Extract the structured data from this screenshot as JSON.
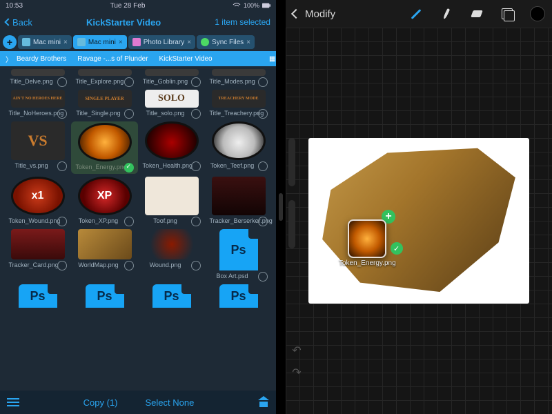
{
  "statusbar": {
    "time": "10:53",
    "date": "Tue 28 Feb"
  },
  "left": {
    "back": "Back",
    "title": "KickStarter Video",
    "selection": "1 item selected",
    "tabs": [
      {
        "label": "Mac mini"
      },
      {
        "label": "Mac mini"
      },
      {
        "label": "Photo Library"
      },
      {
        "label": "Sync Files"
      }
    ],
    "breadcrumbs": [
      "Beardy Brothers",
      "Ravage -...s of Plunder",
      "KickStarter Video"
    ],
    "row_truncated": [
      {
        "name": "Title_Delve.png"
      },
      {
        "name": "Title_Explore.png"
      },
      {
        "name": "Title_Goblin.png"
      },
      {
        "name": "Title_Modes.png"
      }
    ],
    "row_titles": [
      {
        "name": "Title_NoHeroes.png",
        "art": "AIN'T NO HEROES HERE"
      },
      {
        "name": "Title_Single.png",
        "art": "SINGLE PLAYER"
      },
      {
        "name": "Title_solo.png",
        "art": "SOLO"
      },
      {
        "name": "Title_Treachery.png",
        "art": "TREACHERY MODE"
      }
    ],
    "row_tokens1": [
      {
        "name": "Title_vs.png",
        "kind": "vs"
      },
      {
        "name": "Token_Energy.png",
        "kind": "energy",
        "selected": true
      },
      {
        "name": "Token_Health.png",
        "kind": "health"
      },
      {
        "name": "Token_Teef.png",
        "kind": "teef"
      }
    ],
    "row_tokens2": [
      {
        "name": "Token_Wound.png",
        "kind": "wound",
        "badge": "x1"
      },
      {
        "name": "Token_XP.png",
        "kind": "xp",
        "badge": "XP"
      },
      {
        "name": "Toof.png",
        "kind": "toof"
      },
      {
        "name": "Tracker_Berserker.png",
        "kind": "tracker"
      }
    ],
    "row_misc": [
      {
        "name": "Tracker_Card.png",
        "kind": "card"
      },
      {
        "name": "WorldMap.png",
        "kind": "map"
      },
      {
        "name": "Wound.png",
        "kind": "woundimg"
      },
      {
        "name": "Box Art.psd",
        "kind": "psd"
      }
    ],
    "row_psd": [
      {
        "kind": "psd"
      },
      {
        "kind": "psd"
      },
      {
        "kind": "psd"
      },
      {
        "kind": "psd"
      }
    ],
    "ps_label": "Ps",
    "bottom": {
      "copy": "Copy (1)",
      "select_none": "Select None"
    }
  },
  "right": {
    "title": "Modify",
    "drag": {
      "label": "Token_Energy.png"
    }
  }
}
